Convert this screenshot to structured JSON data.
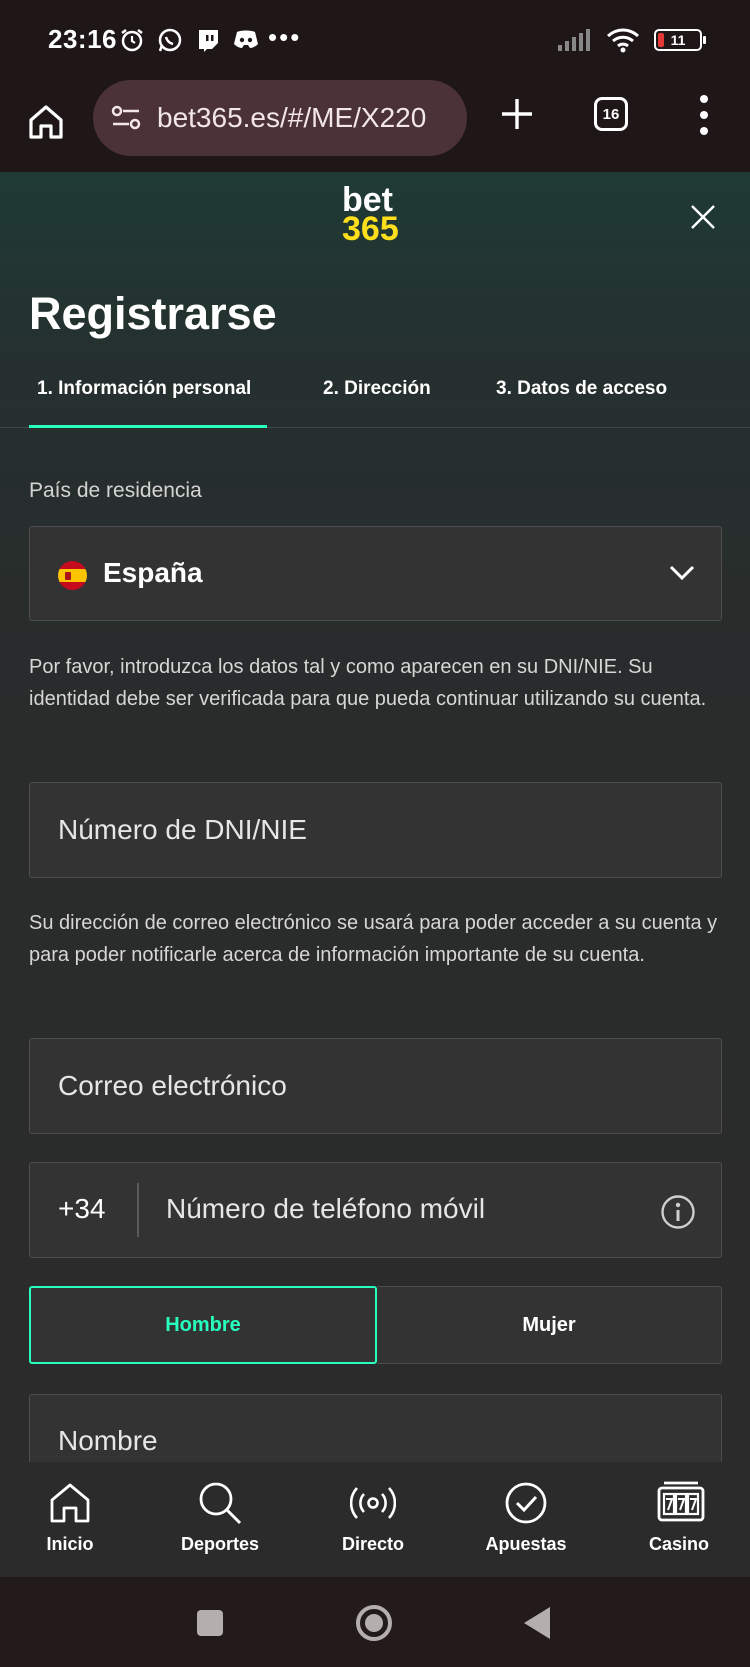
{
  "status_bar": {
    "time": "23:16",
    "battery": "11",
    "more": "•••"
  },
  "browser": {
    "url": "bet365.es/#/ME/X220",
    "tab_count": "16"
  },
  "logo": {
    "line1": "bet",
    "line2": "365"
  },
  "page_title": "Registrarse",
  "steps": [
    {
      "label": "1.  Información personal"
    },
    {
      "label": "2.  Dirección"
    },
    {
      "label": "3.  Datos de acceso"
    }
  ],
  "form": {
    "country_label": "País de residencia",
    "country_value": "España",
    "id_notice": "Por favor, introduzca los datos tal y como aparecen en su DNI/NIE. Su identidad debe ser verificada para que pueda continuar utilizando su cuenta.",
    "dni_placeholder": "Número de DNI/NIE",
    "email_notice": "Su dirección de correo electrónico se usará para poder acceder a su cuenta y para poder notificarle acerca de información importante de su cuenta.",
    "email_placeholder": "Correo electrónico",
    "phone_prefix": "+34",
    "phone_placeholder": "Número de teléfono móvil",
    "gender_male": "Hombre",
    "gender_female": "Mujer",
    "name_placeholder": "Nombre"
  },
  "bottom_nav": [
    {
      "label": "Inicio",
      "icon": "home-icon"
    },
    {
      "label": "Deportes",
      "icon": "search-icon"
    },
    {
      "label": "Directo",
      "icon": "live-broadcast-icon"
    },
    {
      "label": "Apuestas",
      "icon": "checkmark-circle-icon"
    },
    {
      "label": "Casino",
      "icon": "slot-machine-icon"
    }
  ],
  "colors": {
    "accent": "#26ffbe",
    "logo_yellow": "#ffdf1b",
    "background": "#2b2b2b"
  }
}
